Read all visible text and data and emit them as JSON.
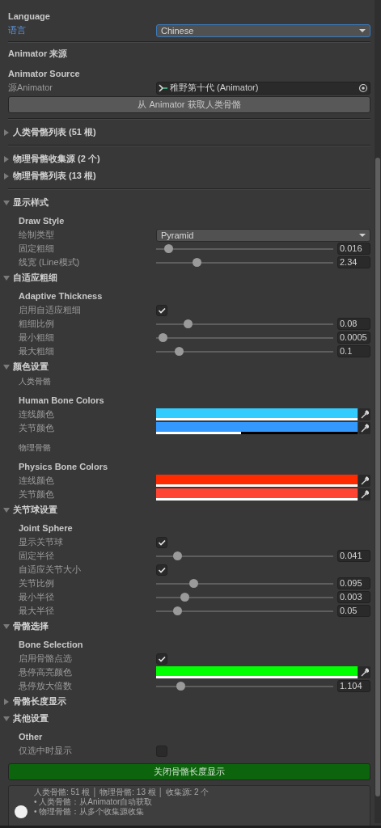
{
  "rows": [
    {
      "kind": "heading",
      "text": "Language"
    },
    {
      "kind": "dropdown",
      "label": "语言",
      "value": "Chinese",
      "focused": true
    },
    {
      "kind": "divider"
    },
    {
      "kind": "title",
      "text": "Animator 来源"
    },
    {
      "kind": "heading",
      "text": "Animator Source"
    },
    {
      "kind": "object_field",
      "label": "源Animator",
      "value": "稚野第十代 (Animator)"
    },
    {
      "kind": "button",
      "label": "从 Animator 获取人类骨骼",
      "highlighted": false
    },
    {
      "kind": "divider"
    },
    {
      "kind": "foldout",
      "label": "人类骨骼列表 (51 根)",
      "expanded": false
    },
    {
      "kind": "divider"
    },
    {
      "kind": "foldout",
      "label": "物理骨骼收集源 (2 个)",
      "expanded": false
    },
    {
      "kind": "foldout",
      "label": "物理骨骼列表 (13 根)",
      "expanded": false
    },
    {
      "kind": "divider"
    },
    {
      "kind": "foldout",
      "label": "显示样式",
      "expanded": true,
      "children": [
        {
          "kind": "heading",
          "text": "Draw Style"
        },
        {
          "kind": "dropdown",
          "label": "绘制类型",
          "value": "Pyramid",
          "focused": false
        },
        {
          "kind": "slider",
          "label": "固定粗细",
          "level": 0.05,
          "value": "0.016"
        },
        {
          "kind": "slider",
          "label": "线宽 (Line模式)",
          "level": 0.21,
          "value": "2.34"
        }
      ]
    },
    {
      "kind": "foldout",
      "label": "自适应粗细",
      "expanded": true,
      "children": [
        {
          "kind": "heading",
          "text": "Adaptive Thickness"
        },
        {
          "kind": "checkbox",
          "label": "启用自适应粗细",
          "checked": true
        },
        {
          "kind": "slider",
          "label": "粗细比例",
          "level": 0.16,
          "value": "0.08"
        },
        {
          "kind": "slider",
          "label": "最小粗细",
          "level": 0.02,
          "value": "0.0005"
        },
        {
          "kind": "slider",
          "label": "最大粗细",
          "level": 0.11,
          "value": "0.1"
        }
      ]
    },
    {
      "kind": "foldout",
      "label": "颜色设置",
      "expanded": true,
      "children": [
        {
          "kind": "caption",
          "text": "人类骨骼"
        },
        {
          "kind": "heading",
          "text": "Human Bone Colors"
        },
        {
          "kind": "color",
          "label": "连线颜色",
          "color": "#33ccff",
          "level": 1
        },
        {
          "kind": "color",
          "label": "关节颜色",
          "color": "#3399ff",
          "level": 0.42
        },
        {
          "kind": "caption",
          "text": "物理骨骼"
        },
        {
          "kind": "heading",
          "text": "Physics Bone Colors"
        },
        {
          "kind": "color",
          "label": "连线颜色",
          "color": "#ff2a00",
          "level": 1
        },
        {
          "kind": "color",
          "label": "关节颜色",
          "color": "#ff4433",
          "level": 1
        }
      ]
    },
    {
      "kind": "foldout",
      "label": "关节球设置",
      "expanded": true,
      "children": [
        {
          "kind": "heading",
          "text": "Joint Sphere"
        },
        {
          "kind": "checkbox",
          "label": "显示关节球",
          "checked": true
        },
        {
          "kind": "slider",
          "label": "固定半径",
          "level": 0.1,
          "value": "0.041"
        },
        {
          "kind": "checkbox",
          "label": "自适应关节大小",
          "checked": true
        },
        {
          "kind": "slider",
          "label": "关节比例",
          "level": 0.19,
          "value": "0.095"
        },
        {
          "kind": "slider",
          "label": "最小半径",
          "level": 0.14,
          "value": "0.003"
        },
        {
          "kind": "slider",
          "label": "最大半径",
          "level": 0.1,
          "value": "0.05"
        }
      ]
    },
    {
      "kind": "foldout",
      "label": "骨骼选择",
      "expanded": true,
      "children": [
        {
          "kind": "heading",
          "text": "Bone Selection"
        },
        {
          "kind": "checkbox",
          "label": "启用骨骼点选",
          "checked": true
        },
        {
          "kind": "color",
          "label": "悬停高亮颜色",
          "color": "#00ff00",
          "level": 1
        },
        {
          "kind": "slider",
          "label": "悬停放大倍数",
          "level": 0.12,
          "value": "1.104"
        }
      ]
    },
    {
      "kind": "foldout",
      "label": "骨骼长度显示",
      "expanded": false
    },
    {
      "kind": "foldout",
      "label": "其他设置",
      "expanded": true,
      "children": [
        {
          "kind": "heading",
          "text": "Other"
        },
        {
          "kind": "checkbox",
          "label": "仅选中时显示",
          "checked": false
        }
      ]
    },
    {
      "kind": "button",
      "label": "关闭骨骼长度显示",
      "highlighted": true
    },
    {
      "kind": "info",
      "lines": [
        "人类骨骼: 51 根 │ 物理骨骼: 13 根 │ 收集源: 2 个",
        "• 人类骨骼：从Animator自动获取",
        "• 物理骨骼：从多个收集源收集"
      ]
    }
  ]
}
